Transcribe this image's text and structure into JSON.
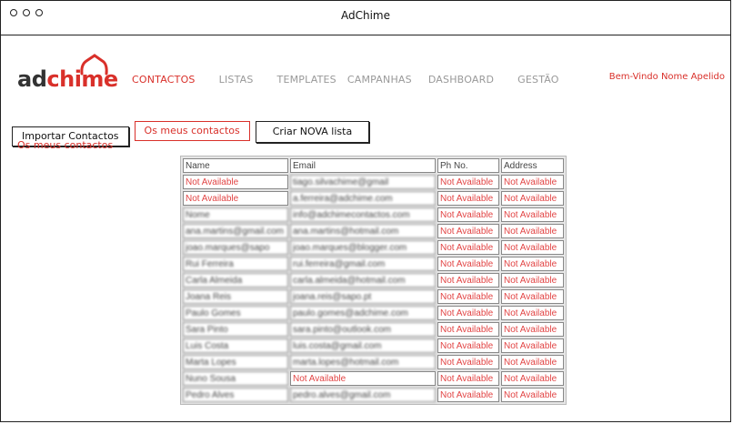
{
  "window": {
    "title": "AdChime"
  },
  "logo": {
    "text_ad": "ad",
    "text_chime": "chime"
  },
  "nav": {
    "items": [
      {
        "label": "CONTACTOS",
        "active": true
      },
      {
        "label": "LISTAS",
        "active": false
      },
      {
        "label": "TEMPLATES",
        "active": false
      },
      {
        "label": "CAMPANHAS",
        "active": false
      },
      {
        "label": "DASHBOARD",
        "active": false
      },
      {
        "label": "GESTÃO",
        "active": false
      }
    ],
    "welcome": "Bem-Vindo Nome Apelido"
  },
  "toolbar": {
    "import_label": "Importar Contactos",
    "my_contacts_label": "Os meus contactos",
    "new_list_label": "Criar NOVA lista"
  },
  "section_label": "Os meus contactos",
  "table": {
    "headers": [
      "Name",
      "Email",
      "Ph No.",
      "Address"
    ],
    "rows": [
      [
        "Not Available",
        "tiago.silvachime@gmail",
        "Not Available",
        "Not Available"
      ],
      [
        "Not Available",
        "a.ferreira@adchime.com",
        "Not Available",
        "Not Available"
      ],
      [
        "Nome",
        "info@adchimecontactos.com",
        "Not Available",
        "Not Available"
      ],
      [
        "ana.martins@gmail.com",
        "ana.martins@hotmail.com",
        "Not Available",
        "Not Available"
      ],
      [
        "joao.marques@sapo",
        "joao.marques@blogger.com",
        "Not Available",
        "Not Available"
      ],
      [
        "Rui Ferreira",
        "rui.ferreira@gmail.com",
        "Not Available",
        "Not Available"
      ],
      [
        "Carla Almeida",
        "carla.almeida@hotmail.com",
        "Not Available",
        "Not Available"
      ],
      [
        "Joana Reis",
        "joana.reis@sapo.pt",
        "Not Available",
        "Not Available"
      ],
      [
        "Paulo Gomes",
        "paulo.gomes@adchime.com",
        "Not Available",
        "Not Available"
      ],
      [
        "Sara Pinto",
        "sara.pinto@outlook.com",
        "Not Available",
        "Not Available"
      ],
      [
        "Luis Costa",
        "luis.costa@gmail.com",
        "Not Available",
        "Not Available"
      ],
      [
        "Marta Lopes",
        "marta.lopes@hotmail.com",
        "Not Available",
        "Not Available"
      ],
      [
        "Nuno Sousa",
        "Not Available",
        "Not Available",
        "Not Available"
      ],
      [
        "Pedro Alves",
        "pedro.alves@gmail.com",
        "Not Available",
        "Not Available"
      ]
    ],
    "not_available_text": "Not Available"
  },
  "colors": {
    "accent": "#d9302a",
    "muted": "#999999"
  }
}
